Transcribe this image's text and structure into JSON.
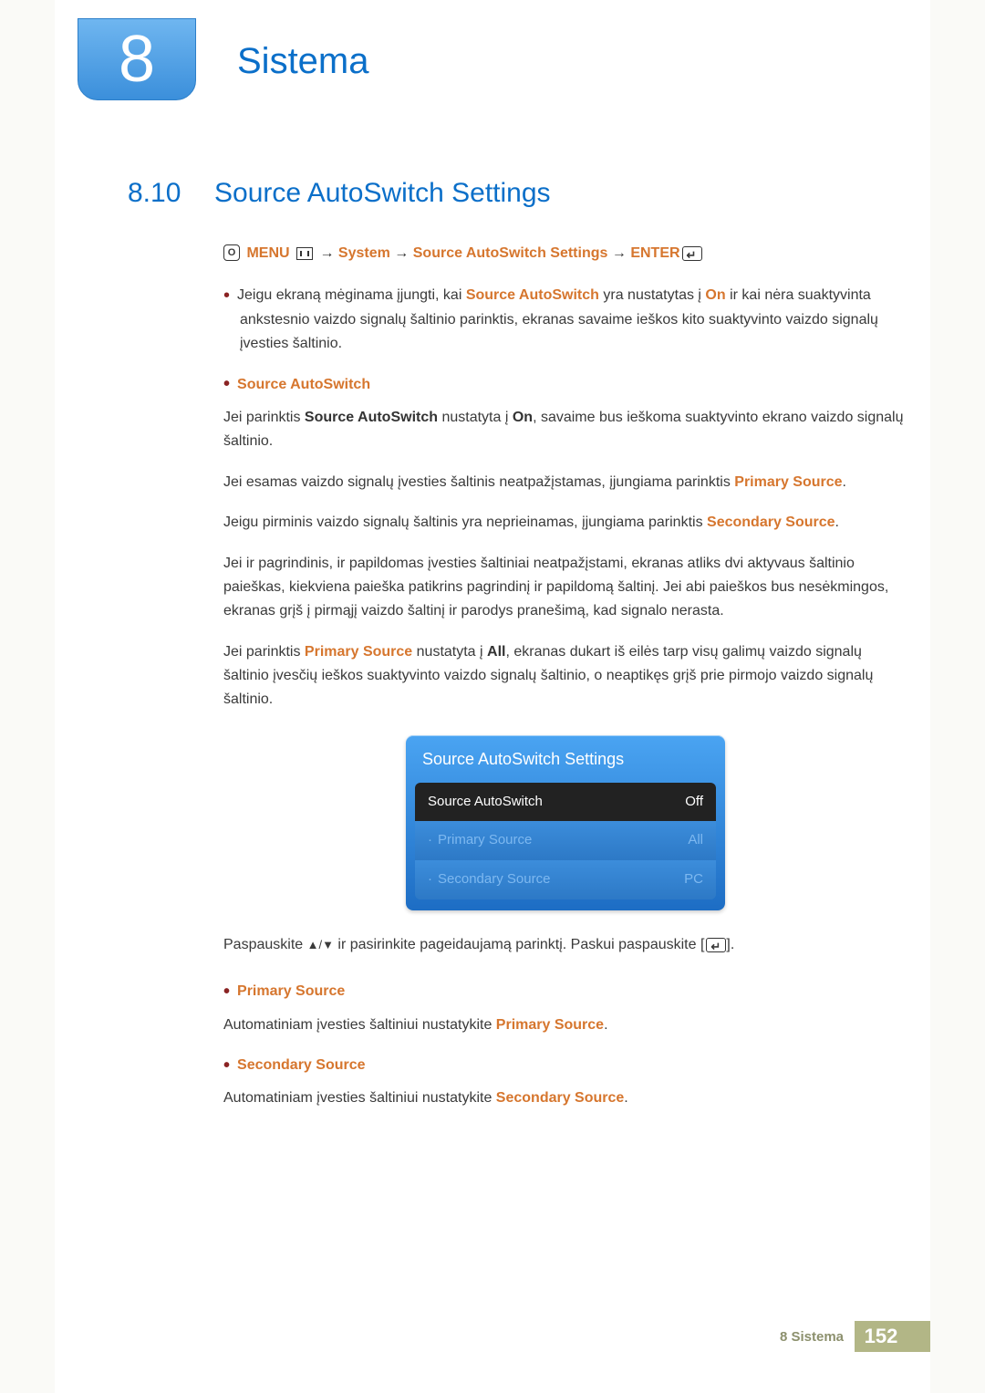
{
  "chapter": {
    "number": "8",
    "title": "Sistema"
  },
  "section": {
    "number": "8.10",
    "title": "Source AutoSwitch Settings"
  },
  "osd_path": {
    "menu_label": "MENU",
    "p1": "System",
    "p2": "Source AutoSwitch Settings",
    "enter_label": "ENTER",
    "arrow": "→"
  },
  "intro": {
    "t1": "Jeigu ekraną mėginama įjungti, kai ",
    "b1": "Source AutoSwitch",
    "t2": " yra nustatytas į ",
    "b2": "On",
    "t3": " ir kai nėra suaktyvinta ankstesnio vaizdo signalų šaltinio parinktis, ekranas savaime ieškos kito suaktyvinto vaizdo signalų įvesties šaltinio."
  },
  "auto": {
    "heading": "Source AutoSwitch",
    "p1_a": "Jei parinktis ",
    "p1_b": "Source AutoSwitch",
    "p1_c": " nustatyta į ",
    "p1_d": "On",
    "p1_e": ", savaime bus ieškoma suaktyvinto ekrano vaizdo signalų šaltinio.",
    "p2_a": "Jei esamas vaizdo signalų įvesties šaltinis neatpažįstamas, įjungiama parinktis ",
    "p2_b": "Primary Source",
    "p2_c": ".",
    "p3_a": "Jeigu pirminis vaizdo signalų šaltinis yra neprieinamas, įjungiama parinktis ",
    "p3_b": "Secondary Source",
    "p3_c": ".",
    "p4": "Jei ir pagrindinis, ir papildomas įvesties šaltiniai neatpažįstami, ekranas atliks dvi aktyvaus šaltinio paieškas, kiekviena paieška patikrins pagrindinį ir papildomą šaltinį. Jei abi paieškos bus nesėkmingos, ekranas grįš į pirmąjį vaizdo šaltinį ir parodys pranešimą, kad signalo nerasta.",
    "p5_a": "Jei parinktis ",
    "p5_b": "Primary Source",
    "p5_c": " nustatyta į ",
    "p5_d": "All",
    "p5_e": ", ekranas dukart iš eilės tarp visų galimų vaizdo signalų šaltinio įvesčių ieškos suaktyvinto vaizdo signalų šaltinio, o neaptikęs grįš prie pirmojo vaizdo signalų šaltinio."
  },
  "osd_panel": {
    "title": "Source AutoSwitch Settings",
    "rows": [
      {
        "label": "Source AutoSwitch",
        "value": "Off"
      },
      {
        "label": "Primary Source",
        "value": "All"
      },
      {
        "label": "Secondary Source",
        "value": "PC"
      }
    ]
  },
  "instruction": {
    "a": "Paspauskite ",
    "b": " ir pasirinkite pageidaujamą parinktį. Paskui paspauskite [",
    "c": "]."
  },
  "primary": {
    "heading": "Primary Source",
    "t1": "Automatiniam įvesties šaltiniui nustatykite ",
    "b1": "Primary Source",
    "t2": "."
  },
  "secondary": {
    "heading": "Secondary Source",
    "t1": "Automatiniam įvesties šaltiniui nustatykite ",
    "b1": "Secondary Source",
    "t2": "."
  },
  "footer": {
    "text": "8 Sistema",
    "page": "152"
  }
}
